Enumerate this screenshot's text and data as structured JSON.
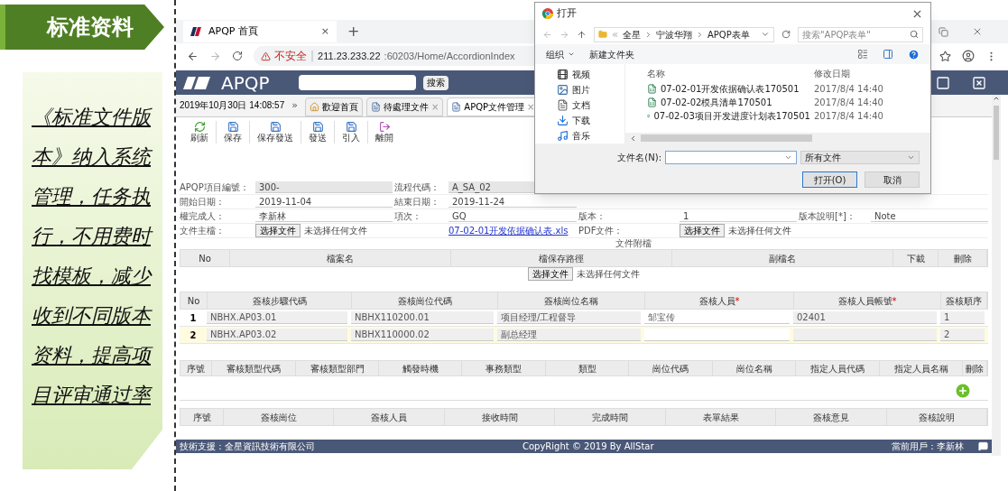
{
  "slide": {
    "banner": "标准资料",
    "note": "《标准文件版本》纳入系统管理，任务执行，不用费时找模板，减少收到不同版本资料，提高项目评审通过率"
  },
  "browser": {
    "tab_title": "APQP 首頁",
    "tab_close": "×",
    "new_tab": "+",
    "warning": "不安全",
    "separator": "|",
    "url_host": "211.23.233.22",
    "url_path": ":60203/Home/AccordionIndex"
  },
  "app": {
    "logo": "APQP",
    "search_button": "搜索",
    "datetime": "2019年10月30日 14:08:57",
    "more": "»",
    "tabs": [
      {
        "label": "歡迎首頁",
        "kind": "home",
        "selected": false
      },
      {
        "label": "待處理文件",
        "kind": "doc",
        "close_mark": "×",
        "selected": false
      },
      {
        "label": "APQP文件管理",
        "kind": "doc",
        "close_mark": "×",
        "selected": true
      }
    ],
    "toolbar": [
      {
        "label": "刷新",
        "kind": "refresh"
      },
      {
        "label": "保存",
        "kind": "save"
      },
      {
        "label": "保存發送",
        "kind": "save"
      },
      {
        "label": "發送",
        "kind": "save"
      },
      {
        "label": "引入",
        "kind": "save"
      },
      {
        "label": "離開",
        "kind": "exit"
      }
    ],
    "form_rows": [
      [
        {
          "label": "APQP項目編號：",
          "kind": "text",
          "value": "300-",
          "readonly": true
        },
        {
          "label": "流程代碼：",
          "kind": "text",
          "value": "A_SA_02",
          "readonly": true
        }
      ],
      [
        {
          "label": "開始日期：",
          "kind": "text",
          "value": "2019-11-04",
          "readonly": false
        },
        {
          "label": "結束日期：",
          "kind": "text",
          "value": "2019-11-24",
          "readonly": false
        }
      ],
      [
        {
          "label": "權完成人：",
          "kind": "text",
          "value": "李新林",
          "readonly": false
        },
        {
          "label": "項次：",
          "kind": "text",
          "value": "GQ",
          "readonly": false
        },
        {
          "label": "版本：",
          "kind": "text",
          "value": "1",
          "readonly": false
        },
        {
          "label": "版本說明[*]：",
          "kind": "text",
          "value": "Note",
          "readonly": false
        }
      ],
      [
        {
          "label": "文件主檔：",
          "kind": "file",
          "button": "选择文件",
          "status": "未选择任何文件"
        },
        {
          "kind": "link",
          "value": "07-02-01开发依据确认表.xls"
        },
        {
          "label": "PDF文件：",
          "kind": "file",
          "button": "选择文件",
          "status": "未选择任何文件"
        }
      ]
    ],
    "attachments": {
      "title": "文件附檔",
      "columns": [
        "No",
        "檔案名",
        "檔保存路徑",
        "副檔名",
        "下載",
        "刪除"
      ],
      "button": "选择文件",
      "status": "未选择任何文件"
    },
    "sign_table": {
      "columns": [
        {
          "label": "No"
        },
        {
          "label": "簽核步驟代碼"
        },
        {
          "label": "簽核崗位代碼"
        },
        {
          "label": "簽核崗位名稱"
        },
        {
          "label": "簽核人員",
          "required_mark": "*"
        },
        {
          "label": "簽核人員帳號",
          "required_mark": "*"
        },
        {
          "label": "簽核順序"
        }
      ],
      "rows": [
        {
          "no": "1",
          "selected": false,
          "cells": [
            "NBHX.AP03.01",
            "NBHX110200.01",
            "项目经理/工程督导",
            "邹宝传",
            "02401",
            "1"
          ]
        },
        {
          "no": "2",
          "selected": true,
          "cells": [
            "NBHX.AP03.02",
            "NBHX110000.02",
            "副总经理",
            null,
            null,
            "2"
          ]
        }
      ]
    },
    "audit_table": {
      "columns": [
        "序號",
        "審核類型代碼",
        "審核類型部門",
        "觸發時機",
        "事務類型",
        "類型",
        "崗位代碼",
        "崗位名稱",
        "指定人員代碼",
        "指定人員名稱",
        "刪除"
      ]
    },
    "record_table": {
      "columns": [
        "序號",
        "簽核崗位",
        "簽核人員",
        "接收時間",
        "完成時間",
        "表單結果",
        "簽核意見",
        "簽核說明"
      ]
    },
    "footer": {
      "support": "技術支援：全星資訊技術有限公司",
      "copyright": "CopyRight © 2019 By AllStar",
      "user": "當前用戶：李新林"
    }
  },
  "dialog": {
    "title": "打开",
    "path": [
      "全星",
      "宁波华翔",
      "APQP表单"
    ],
    "search_placeholder": "搜索\"APQP表单\"",
    "organize": "组织",
    "new_folder": "新建文件夹",
    "nav": [
      {
        "label": "视频",
        "kind": "video"
      },
      {
        "label": "图片",
        "kind": "image"
      },
      {
        "label": "文档",
        "kind": "doc"
      },
      {
        "label": "下载",
        "kind": "download"
      },
      {
        "label": "音乐",
        "kind": "music"
      }
    ],
    "columns": [
      "名称",
      "修改日期"
    ],
    "files": [
      {
        "name": "07-02-01开发依据确认表170501",
        "date": "2017/8/4 14:40"
      },
      {
        "name": "07-02-02模具清单170501",
        "date": "2017/8/4 14:40"
      },
      {
        "name": "07-02-03项目开发进度计划表170501",
        "date": "2017/8/4 14:40"
      }
    ],
    "filename_label": "文件名(N):",
    "filetype": "所有文件",
    "buttons": [
      {
        "label": "打开(O)",
        "default": true
      },
      {
        "label": "取消",
        "default": false
      }
    ]
  }
}
